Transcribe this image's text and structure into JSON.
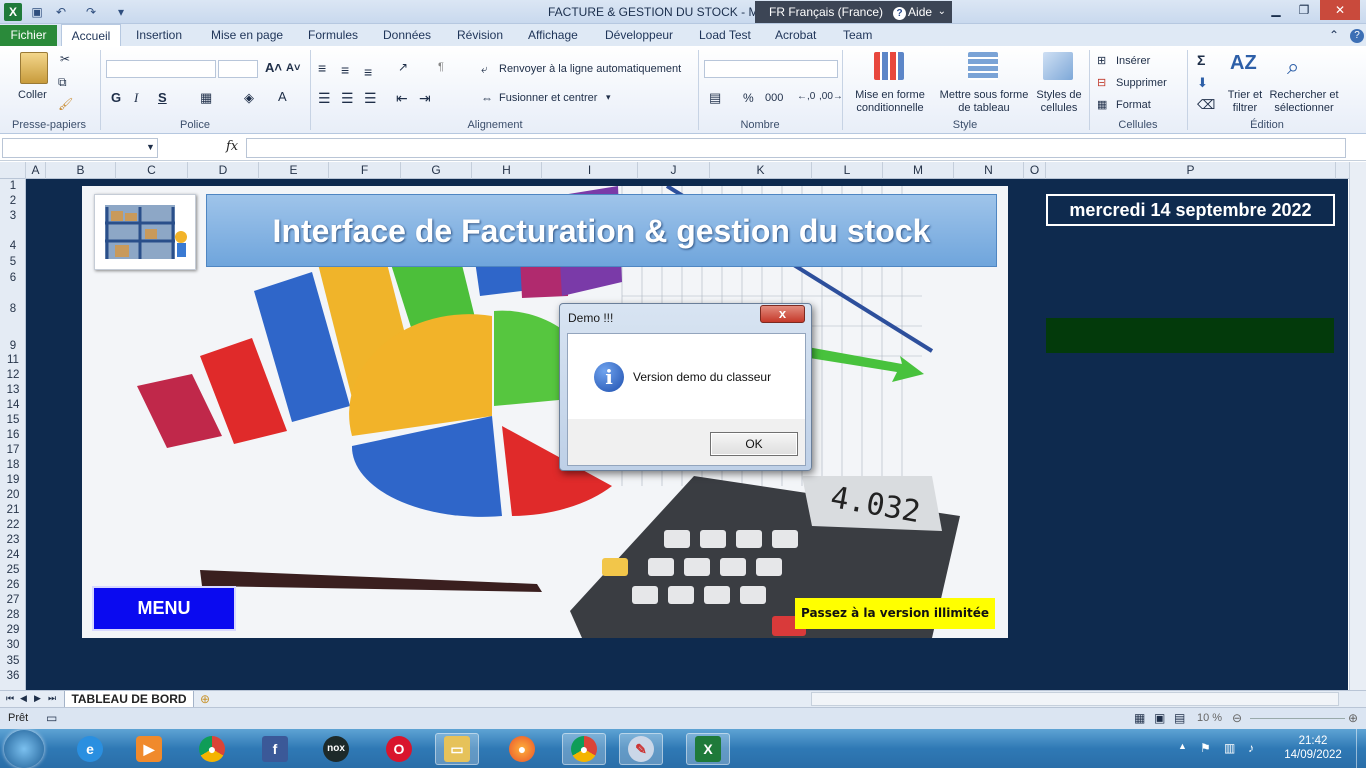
{
  "window": {
    "title": "FACTURE & GESTION DU STOCK - M",
    "language": "FR Français (France)",
    "help": "Aide"
  },
  "tabs": [
    "Fichier",
    "Accueil",
    "Insertion",
    "Mise en page",
    "Formules",
    "Données",
    "Révision",
    "Affichage",
    "Développeur",
    "Load Test",
    "Acrobat",
    "Team"
  ],
  "ribbon": {
    "clipboard": {
      "paste": "Coller",
      "label": "Presse-papiers"
    },
    "font": {
      "bold": "G",
      "italic": "I",
      "underline": "S",
      "label": "Police"
    },
    "alignment": {
      "wrap": "Renvoyer à la ligne automatiquement",
      "merge": "Fusionner et centrer",
      "label": "Alignement"
    },
    "number": {
      "percent": "%",
      "thousands": "000",
      "label": "Nombre"
    },
    "style": {
      "conditional": "Mise en forme conditionnelle",
      "table": "Mettre sous forme de tableau",
      "cell_styles": "Styles de cellules",
      "label": "Style"
    },
    "cells": {
      "insert": "Insérer",
      "delete": "Supprimer",
      "format": "Format",
      "label": "Cellules"
    },
    "editing": {
      "sort": "Trier et filtrer",
      "find": "Rechercher et sélectionner",
      "label": "Édition"
    }
  },
  "formula_bar": {
    "fx": "fx",
    "value": ""
  },
  "columns": [
    "A",
    "B",
    "C",
    "D",
    "E",
    "F",
    "G",
    "H",
    "I",
    "J",
    "K",
    "L",
    "M",
    "N",
    "O",
    "P"
  ],
  "rows": [
    "1",
    "2",
    "3",
    "4",
    "5",
    "6",
    "8",
    "9",
    "11",
    "12",
    "13",
    "14",
    "15",
    "16",
    "17",
    "18",
    "19",
    "20",
    "21",
    "22",
    "23",
    "24",
    "25",
    "26",
    "27",
    "28",
    "29",
    "30",
    "35",
    "36"
  ],
  "dashboard": {
    "banner_title": "Interface de Facturation & gestion du stock",
    "date": "mercredi 14 septembre 2022",
    "menu": "MENU",
    "unlimited": "Passez à la version illimitée",
    "calculator_display": "4.032"
  },
  "dialog": {
    "title": "Demo !!!",
    "message": "Version demo du classeur",
    "ok": "OK",
    "close": "x"
  },
  "sheet_tab": "TABLEAU DE BORD",
  "status": {
    "ready": "Prêt",
    "zoom": "10 %"
  },
  "taskbar": {
    "time": "21:42",
    "date": "14/09/2022"
  },
  "colors": {
    "sheet_bg": "#0e2a4e",
    "banner": "#7fb0e2",
    "menu": "#0a0af0",
    "unlimited": "#ffff00",
    "green_box": "#033a0b",
    "excel_green": "#2a8a3a"
  }
}
